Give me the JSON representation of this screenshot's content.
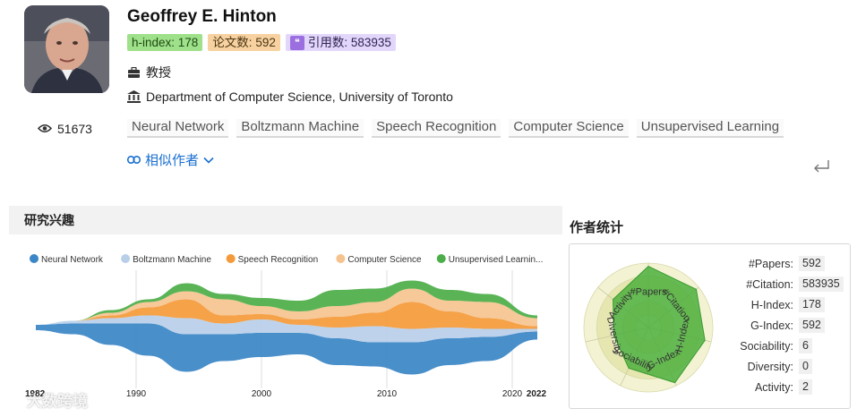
{
  "profile": {
    "name": "Geoffrey E. Hinton",
    "h_index_label": "h-index: 178",
    "papers_label": "论文数: 592",
    "citations_label": "引用数: 583935",
    "title": "教授",
    "affiliation": "Department of Computer Science, University of Toronto",
    "views": "51673",
    "tags": [
      "Neural Network",
      "Boltzmann Machine",
      "Speech Recognition",
      "Computer Science",
      "Unsupervised Learning"
    ],
    "similar_authors_label": "相似作者"
  },
  "research_interests": {
    "title": "研究兴趣",
    "legend": [
      {
        "name": "Neural Network",
        "color": "#3a86c6"
      },
      {
        "name": "Boltzmann Machine",
        "color": "#b9cfe9"
      },
      {
        "name": "Speech Recognition",
        "color": "#f49a3a"
      },
      {
        "name": "Computer Science",
        "color": "#f6c38f"
      },
      {
        "name": "Unsupervised Learnin...",
        "color": "#4cae48"
      }
    ],
    "x_ticks": [
      "1982",
      "1990",
      "2000",
      "2010",
      "2020",
      "2022"
    ]
  },
  "chart_data": {
    "type": "area",
    "x": [
      1982,
      1985,
      1988,
      1991,
      1994,
      1997,
      2000,
      2003,
      2006,
      2009,
      2012,
      2015,
      2018,
      2022
    ],
    "series": [
      {
        "name": "Neural Network",
        "values": [
          2,
          4,
          8,
          12,
          14,
          10,
          9,
          8,
          10,
          9,
          12,
          10,
          9,
          3
        ]
      },
      {
        "name": "Boltzmann Machine",
        "values": [
          0,
          1,
          2,
          3,
          6,
          4,
          5,
          3,
          4,
          6,
          5,
          4,
          3,
          1
        ]
      },
      {
        "name": "Speech Recognition",
        "values": [
          0,
          0,
          1,
          3,
          7,
          3,
          2,
          2,
          4,
          5,
          10,
          6,
          4,
          1
        ]
      },
      {
        "name": "Computer Science",
        "values": [
          0,
          0,
          1,
          2,
          3,
          6,
          3,
          3,
          4,
          4,
          5,
          4,
          6,
          3
        ]
      },
      {
        "name": "Unsupervised Learnin...",
        "values": [
          0,
          0,
          1,
          1,
          3,
          2,
          3,
          4,
          6,
          5,
          3,
          4,
          3,
          1
        ]
      }
    ],
    "xlabel": "",
    "ylabel": "",
    "legend": "top",
    "grid": true
  },
  "author_stats": {
    "title": "作者统计",
    "radar_labels": [
      "#Papers",
      "#Citation",
      "H-Index",
      "G-Index",
      "Sociability",
      "Diversity",
      "Activity"
    ],
    "radar_values": [
      0.95,
      0.95,
      0.9,
      0.95,
      0.7,
      0.55,
      0.7
    ],
    "stats": [
      {
        "label": "#Papers:",
        "value": "592"
      },
      {
        "label": "#Citation:",
        "value": "583935"
      },
      {
        "label": "H-Index:",
        "value": "178"
      },
      {
        "label": "G-Index:",
        "value": "592"
      },
      {
        "label": "Sociability:",
        "value": "6"
      },
      {
        "label": "Diversity:",
        "value": "0"
      },
      {
        "label": "Activity:",
        "value": "2"
      }
    ]
  },
  "watermark": "大数跨境",
  "colors": {
    "accent": "#1a6fd1",
    "radar_fill": "#4caf3d",
    "radar_ring": "#e9e9b8"
  }
}
